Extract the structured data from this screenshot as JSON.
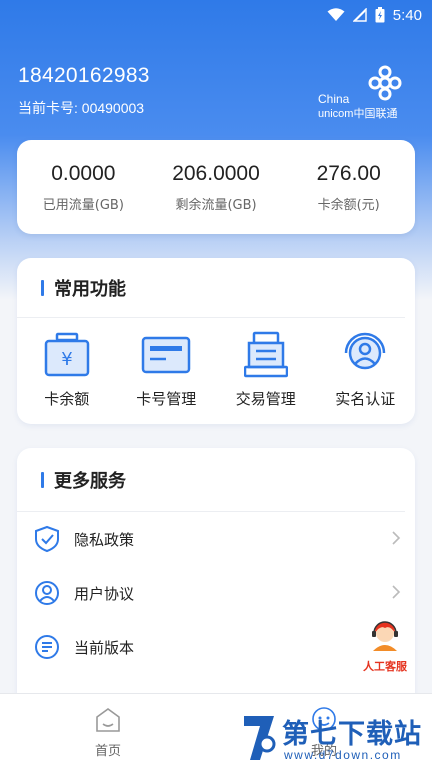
{
  "status_bar": {
    "time": "5:40"
  },
  "account": {
    "phone": "18420162983",
    "card_label": "当前卡号: 00490003"
  },
  "brand": {
    "line1": "China",
    "line2": "unicom中国联通"
  },
  "stats": [
    {
      "value": "0.0000",
      "label": "已用流量(GB)"
    },
    {
      "value": "206.0000",
      "label": "剩余流量(GB)"
    },
    {
      "value": "276.00",
      "label": "卡余额(元)"
    }
  ],
  "common_functions": {
    "title": "常用功能",
    "items": [
      {
        "label": "卡余额",
        "icon": "wallet-icon"
      },
      {
        "label": "卡号管理",
        "icon": "card-icon"
      },
      {
        "label": "交易管理",
        "icon": "transaction-icon"
      },
      {
        "label": "实名认证",
        "icon": "user-verify-icon"
      }
    ]
  },
  "more_services": {
    "title": "更多服务",
    "items": [
      {
        "label": "隐私政策",
        "icon": "shield-icon"
      },
      {
        "label": "用户协议",
        "icon": "user-icon"
      },
      {
        "label": "当前版本",
        "icon": "list-icon"
      }
    ]
  },
  "customer_service": {
    "label": "人工客服"
  },
  "tabs": [
    {
      "label": "首页",
      "icon": "home-icon"
    },
    {
      "label": "我的",
      "icon": "profile-icon"
    }
  ],
  "watermark": {
    "title": "第七下载站",
    "url": "www.d7down.com"
  },
  "colors": {
    "primary": "#2f7ae8",
    "accent": "#e5331f"
  }
}
